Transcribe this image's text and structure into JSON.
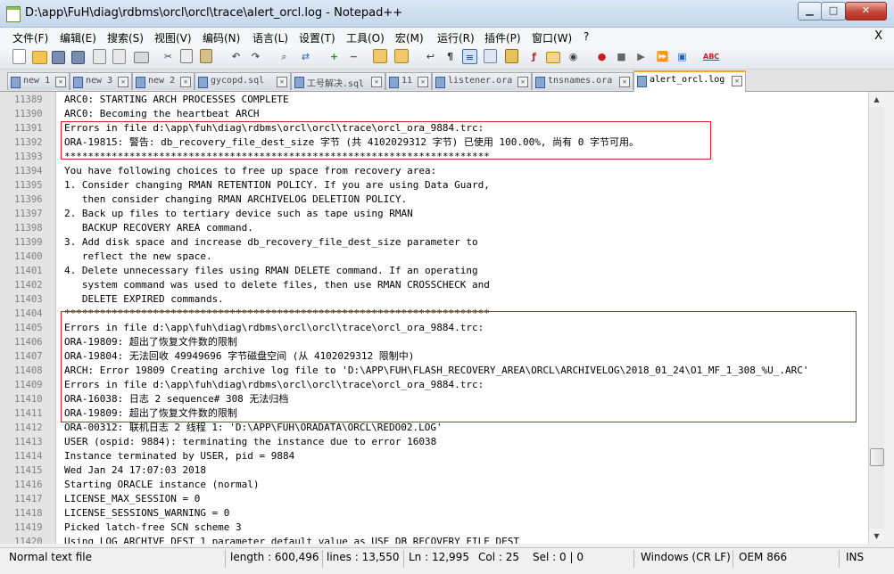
{
  "window": {
    "title": "D:\\app\\FuH\\diag\\rdbms\\orcl\\orcl\\trace\\alert_orcl.log - Notepad++",
    "minimize_glyph": "▁",
    "maximize_glyph": "□",
    "close_glyph": "✕"
  },
  "menu": {
    "items": [
      "文件(F)",
      "编辑(E)",
      "搜索(S)",
      "视图(V)",
      "编码(N)",
      "语言(L)",
      "设置(T)",
      "工具(O)",
      "宏(M)",
      "运行(R)",
      "插件(P)",
      "窗口(W)",
      "?"
    ],
    "close_label": "X"
  },
  "toolbar": {
    "buttons": [
      "new-file",
      "open-file",
      "save",
      "save-all",
      "close",
      "close-all",
      "print",
      "cut",
      "copy",
      "paste",
      "undo",
      "redo",
      "find",
      "replace",
      "zoom-in",
      "zoom-out",
      "sync-vertical",
      "sync-horizontal",
      "word-wrap",
      "show-all-chars",
      "indent-guide",
      "document-map",
      "function-list",
      "folder-workspace",
      "monitoring",
      "record-macro",
      "stop-record",
      "play-macro",
      "run-macro-multiple",
      "save-macro",
      "spell-check"
    ]
  },
  "tabs": [
    {
      "label": "new 1"
    },
    {
      "label": "new 3"
    },
    {
      "label": "new 2"
    },
    {
      "label": "gycopd.sql"
    },
    {
      "label": "工号解决.sql"
    },
    {
      "label": "11"
    },
    {
      "label": "listener.ora"
    },
    {
      "label": "tnsnames.ora"
    },
    {
      "label": "alert_orcl.log"
    }
  ],
  "tab_close_glyph": "✕",
  "editor": {
    "lines": [
      {
        "n": "11389",
        "text": "ARC0: STARTING ARCH PROCESSES COMPLETE"
      },
      {
        "n": "11390",
        "text": "ARC0: Becoming the heartbeat ARCH"
      },
      {
        "n": "11391",
        "text": "Errors in file d:\\app\\fuh\\diag\\rdbms\\orcl\\orcl\\trace\\orcl_ora_9884.trc:"
      },
      {
        "n": "11392",
        "text": "ORA-19815: 警告: db_recovery_file_dest_size 字节 (共 4102029312 字节) 已使用 100.00%, 尚有 0 字节可用。"
      },
      {
        "n": "11393",
        "text": "************************************************************************"
      },
      {
        "n": "11394",
        "text": "You have following choices to free up space from recovery area:"
      },
      {
        "n": "11395",
        "text": "1. Consider changing RMAN RETENTION POLICY. If you are using Data Guard,"
      },
      {
        "n": "11396",
        "text": "   then consider changing RMAN ARCHIVELOG DELETION POLICY."
      },
      {
        "n": "11397",
        "text": "2. Back up files to tertiary device such as tape using RMAN"
      },
      {
        "n": "11398",
        "text": "   BACKUP RECOVERY AREA command."
      },
      {
        "n": "11399",
        "text": "3. Add disk space and increase db_recovery_file_dest_size parameter to"
      },
      {
        "n": "11400",
        "text": "   reflect the new space."
      },
      {
        "n": "11401",
        "text": "4. Delete unnecessary files using RMAN DELETE command. If an operating"
      },
      {
        "n": "11402",
        "text": "   system command was used to delete files, then use RMAN CROSSCHECK and"
      },
      {
        "n": "11403",
        "text": "   DELETE EXPIRED commands."
      },
      {
        "n": "11404",
        "text": "************************************************************************"
      },
      {
        "n": "11405",
        "text": "Errors in file d:\\app\\fuh\\diag\\rdbms\\orcl\\orcl\\trace\\orcl_ora_9884.trc:"
      },
      {
        "n": "11406",
        "text": "ORA-19809: 超出了恢复文件数的限制"
      },
      {
        "n": "11407",
        "text": "ORA-19804: 无法回收 49949696 字节磁盘空间 (从 4102029312 限制中)"
      },
      {
        "n": "11408",
        "text": "ARCH: Error 19809 Creating archive log file to 'D:\\APP\\FUH\\FLASH_RECOVERY_AREA\\ORCL\\ARCHIVELOG\\2018_01_24\\O1_MF_1_308_%U_.ARC'"
      },
      {
        "n": "11409",
        "text": "Errors in file d:\\app\\fuh\\diag\\rdbms\\orcl\\orcl\\trace\\orcl_ora_9884.trc:"
      },
      {
        "n": "11410",
        "text": "ORA-16038: 日志 2 sequence# 308 无法归档"
      },
      {
        "n": "11411",
        "text": "ORA-19809: 超出了恢复文件数的限制"
      },
      {
        "n": "11412",
        "text": "ORA-00312: 联机日志 2 线程 1: 'D:\\APP\\FUH\\ORADATA\\ORCL\\REDO02.LOG'"
      },
      {
        "n": "11413",
        "text": "USER (ospid: 9884): terminating the instance due to error 16038"
      },
      {
        "n": "11414",
        "text": "Instance terminated by USER, pid = 9884"
      },
      {
        "n": "11415",
        "text": "Wed Jan 24 17:07:03 2018"
      },
      {
        "n": "11416",
        "text": "Starting ORACLE instance (normal)"
      },
      {
        "n": "11417",
        "text": "LICENSE_MAX_SESSION = 0"
      },
      {
        "n": "11418",
        "text": "LICENSE_SESSIONS_WARNING = 0"
      },
      {
        "n": "11419",
        "text": "Picked latch-free SCN scheme 3"
      },
      {
        "n": "11420",
        "text": "Using LOG_ARCHIVE_DEST_1 parameter default value as USE_DB_RECOVERY_FILE_DEST"
      }
    ]
  },
  "scrollbar": {
    "up_glyph": "▲",
    "down_glyph": "▼"
  },
  "status": {
    "file_type": "Normal text file",
    "length": "length : 600,496",
    "lines": "lines : 13,550",
    "ln": "Ln : 12,995",
    "col": "Col : 25",
    "sel": "Sel : 0 | 0",
    "eol": "Windows (CR LF)",
    "encoding": "OEM 866",
    "mode": "INS"
  },
  "colors": {
    "highlight_box": "#d8252b",
    "active_tab_accent": "#f5a623"
  }
}
